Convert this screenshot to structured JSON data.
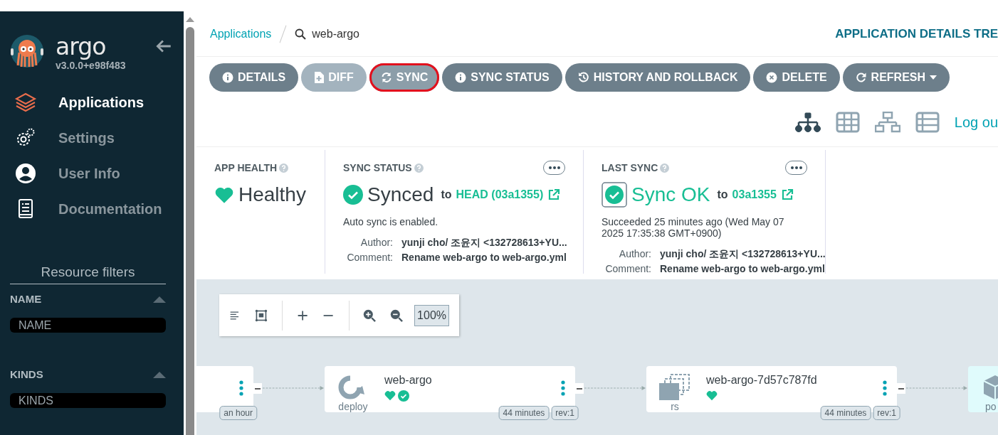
{
  "sidebar": {
    "brand": "argo",
    "version": "v3.0.0+e98f483",
    "items": [
      {
        "label": "Applications",
        "selected": true
      },
      {
        "label": "Settings",
        "selected": false
      },
      {
        "label": "User Info",
        "selected": false
      },
      {
        "label": "Documentation",
        "selected": false
      }
    ],
    "filters_title": "Resource filters",
    "filters": [
      {
        "label": "NAME",
        "placeholder": "NAME"
      },
      {
        "label": "KINDS",
        "placeholder": "KINDS"
      }
    ]
  },
  "breadcrumb": {
    "parent": "Applications",
    "current": "web-argo"
  },
  "page_title": "APPLICATION DETAILS TRE",
  "buttons": [
    {
      "label": "DETAILS",
      "disabled": false,
      "highlighted": false,
      "dropdown": false
    },
    {
      "label": "DIFF",
      "disabled": true,
      "highlighted": false,
      "dropdown": false
    },
    {
      "label": "SYNC",
      "disabled": false,
      "highlighted": true,
      "dropdown": false
    },
    {
      "label": "SYNC STATUS",
      "disabled": false,
      "highlighted": false,
      "dropdown": false
    },
    {
      "label": "HISTORY AND ROLLBACK",
      "disabled": false,
      "highlighted": false,
      "dropdown": false
    },
    {
      "label": "DELETE",
      "disabled": false,
      "highlighted": false,
      "dropdown": false
    },
    {
      "label": "REFRESH",
      "disabled": false,
      "highlighted": false,
      "dropdown": true
    }
  ],
  "views": [
    {
      "kind": "tree",
      "selected": true
    },
    {
      "kind": "grid",
      "selected": false
    },
    {
      "kind": "network",
      "selected": false
    },
    {
      "kind": "list",
      "selected": false
    }
  ],
  "logout": "Log ou",
  "app_health": {
    "title": "APP HEALTH",
    "status": "Healthy"
  },
  "sync_status": {
    "title": "SYNC STATUS",
    "status": "Synced",
    "to": "to",
    "revision": "HEAD (03a1355)",
    "note": "Auto sync is enabled.",
    "details": [
      {
        "label": "Author:",
        "value": "yunji cho/ 조윤지 <132728613+YU..."
      },
      {
        "label": "Comment:",
        "value": "Rename web-argo to web-argo.yml"
      }
    ]
  },
  "last_sync": {
    "title": "LAST SYNC",
    "status": "Sync OK",
    "to": "to",
    "revision": "03a1355",
    "note": "Succeeded 25 minutes ago (Wed May 07 2025 17:35:38 GMT+0900)",
    "details": [
      {
        "label": "Author:",
        "value": "yunji cho/ 조윤지 <132728613+YU..."
      },
      {
        "label": "Comment:",
        "value": "Rename web-argo to web-argo.yml"
      }
    ]
  },
  "zoom": "100%",
  "nodes": [
    {
      "kind": "app",
      "badges": [
        "an hour"
      ]
    },
    {
      "kind": "deploy",
      "name": "web-argo",
      "type": "deploy",
      "healthy": true,
      "synced": true,
      "badges": [
        "44 minutes",
        "rev:1"
      ]
    },
    {
      "kind": "rs",
      "name": "web-argo-7d57c787fd",
      "type": "rs",
      "healthy": true,
      "badges": [
        "44 minutes",
        "rev:1"
      ]
    },
    {
      "kind": "pod",
      "type": "po"
    }
  ]
}
